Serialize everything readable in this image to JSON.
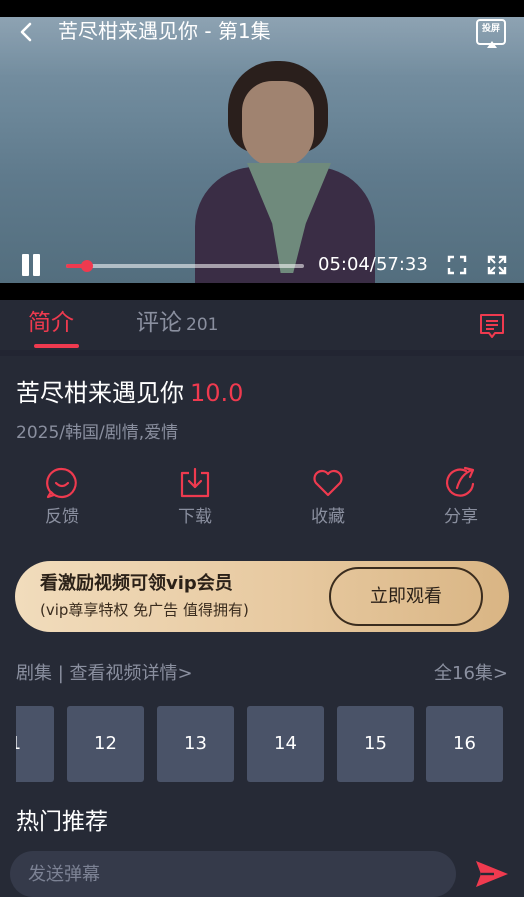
{
  "player": {
    "title": "苦尽柑来遇见你 - 第1集",
    "cast_label": "投屏",
    "current_time": "05:04",
    "duration": "57:33",
    "time_separator": "/",
    "progress": 0.088
  },
  "tabs": {
    "intro": "简介",
    "comments": "评论",
    "comments_count": "201"
  },
  "show": {
    "title": "苦尽柑来遇见你",
    "score": "10.0",
    "meta": "2025/韩国/剧情,爱情"
  },
  "actions": [
    {
      "label": "反馈",
      "icon": "feedback-icon"
    },
    {
      "label": "下载",
      "icon": "download-icon"
    },
    {
      "label": "收藏",
      "icon": "heart-icon"
    },
    {
      "label": "分享",
      "icon": "share-icon"
    }
  ],
  "vip": {
    "title": "看激励视频可领vip会员",
    "subtitle": "(vip尊享特权 免广告 值得拥有)",
    "button": "立即观看"
  },
  "episodes": {
    "link": "剧集 | 查看视频详情>",
    "all": "全16集>",
    "items": [
      "1",
      "12",
      "13",
      "14",
      "15",
      "16"
    ]
  },
  "recommend": {
    "title": "热门推荐"
  },
  "danmaku": {
    "placeholder": "发送弹幕"
  },
  "colors": {
    "accent": "#ef3a4f",
    "background": "#262a36",
    "episode_tile": "#4a5368",
    "muted_text": "#8a8f9f",
    "vip_gold": "#e7c9a0"
  }
}
